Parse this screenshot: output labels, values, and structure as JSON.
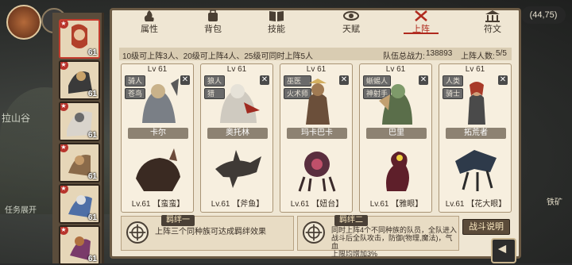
{
  "background": {
    "place_label": "拉山谷",
    "hint_label": "任务展开",
    "side_label": "铁矿"
  },
  "coords": "(44,75)",
  "tabs": [
    {
      "label": "属性",
      "icon": "flame-icon"
    },
    {
      "label": "背包",
      "icon": "backpack-icon"
    },
    {
      "label": "技能",
      "icon": "book-icon"
    },
    {
      "label": "天赋",
      "icon": "eye-icon"
    },
    {
      "label": "上阵",
      "icon": "crossed-swords-icon",
      "active": true
    },
    {
      "label": "符文",
      "icon": "temple-icon"
    }
  ],
  "info": {
    "rule": "10级可上阵3人、20级可上阵4人、25级可同时上阵5人",
    "power_label": "队伍总战力:",
    "power_value": "138893",
    "count_label": "上阵人数:",
    "count_value": "5/5"
  },
  "roster": [
    {
      "level": "61",
      "tag": "★"
    },
    {
      "level": "61",
      "tag": "★"
    },
    {
      "level": "61",
      "tag": "★"
    },
    {
      "level": "61",
      "tag": "★"
    },
    {
      "level": "61",
      "tag": "★"
    },
    {
      "level": "61",
      "tag": "★"
    }
  ],
  "cards": [
    {
      "lv_top": "Lv 61",
      "badges": [
        "骑人",
        "苍鸟"
      ],
      "name": "卡尔",
      "pet_lv": "Lv.61",
      "pet_name": "【蛮蛮】",
      "hero_color": "#7a7f86",
      "pet_color": "#3a2a22"
    },
    {
      "lv_top": "Lv 61",
      "badges": [
        "狼人",
        "猎"
      ],
      "name": "奥托林",
      "pet_lv": "Lv.61",
      "pet_name": "【斧鱼】",
      "hero_color": "#cfcac0",
      "pet_color": "#3f3a36"
    },
    {
      "lv_top": "Lv 61",
      "badges": [
        "巫医",
        "火术师"
      ],
      "name": "玛卡巴卡",
      "pet_lv": "Lv.61",
      "pet_name": "【妞台】",
      "hero_color": "#6b4f3a",
      "pet_color": "#5a2e3e"
    },
    {
      "lv_top": "Lv 61",
      "badges": [
        "蜥蜴人",
        "神射手"
      ],
      "name": "巴里",
      "pet_lv": "Lv.61",
      "pet_name": "【雅眼】",
      "hero_color": "#5a6e4a",
      "pet_color": "#5e1f2a"
    },
    {
      "lv_top": "Lv 61",
      "badges": [
        "人类",
        "骑士"
      ],
      "name": "拓荒者",
      "pet_lv": "Lv.61",
      "pet_name": "【花大眼】",
      "hero_color": "#a83a28",
      "pet_color": "#2e3a4a"
    }
  ],
  "bond1": {
    "title": "羁绊一",
    "text": "上阵三个同种族可达成羁绊效果"
  },
  "bond2": {
    "title": "羁绊二",
    "line1": "同时上阵4个不同种族的队员，全队进入",
    "line2": "战斗后全队攻击，防御(物理,魔法)，气血",
    "line3": "上限均增加3%"
  },
  "battle_button": "战斗说明"
}
